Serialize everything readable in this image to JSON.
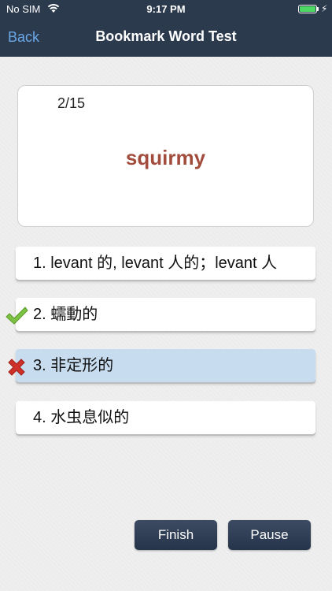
{
  "status_bar": {
    "carrier": "No SIM",
    "time": "9:17 PM",
    "battery_level": 1.0,
    "wifi_icon": "wifi-icon",
    "charging_icon": "bolt-icon"
  },
  "nav": {
    "back_label": "Back",
    "title": "Bookmark Word Test"
  },
  "card": {
    "progress": "2/15",
    "word": "squirmy",
    "word_color": "#a14c3c"
  },
  "options": [
    {
      "label": "1. levant 的, levant 人的；levant 人",
      "state": "none"
    },
    {
      "label": "2. 蠕動的",
      "state": "correct"
    },
    {
      "label": "3. 非定形的",
      "state": "wrong-selected"
    },
    {
      "label": "4. 水虫息似的",
      "state": "none"
    }
  ],
  "marks": {
    "correct_icon": "check-icon",
    "wrong_icon": "cross-icon",
    "correct_color": "#7cc243",
    "wrong_color": "#d0302a"
  },
  "buttons": {
    "finish_label": "Finish",
    "pause_label": "Pause"
  },
  "colors": {
    "nav_background": "#2c3a4e",
    "back_link": "#6aa8e8",
    "selected_option": "#c7dcef"
  }
}
